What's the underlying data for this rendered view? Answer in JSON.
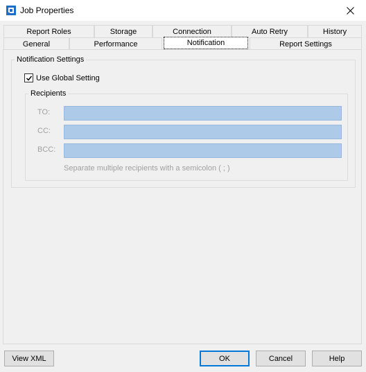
{
  "window": {
    "title": "Job Properties",
    "icon": "app-icon",
    "close_glyph": "✕"
  },
  "tabs": {
    "row1": [
      "Report Roles",
      "Storage",
      "Connection",
      "Auto Retry",
      "History"
    ],
    "row2": [
      "General",
      "Performance",
      "Notification",
      "Report Settings"
    ],
    "active": "Notification"
  },
  "notification": {
    "group_label": "Notification Settings",
    "use_global_label": "Use Global Setting",
    "use_global_checked": true,
    "recipients": {
      "group_label": "Recipients",
      "to_label": "TO:",
      "cc_label": "CC:",
      "bcc_label": "BCC:",
      "to_value": "",
      "cc_value": "",
      "bcc_value": "",
      "hint": "Separate multiple recipients with a semicolon ( ; )"
    }
  },
  "buttons": {
    "view_xml": "View XML",
    "ok": "OK",
    "cancel": "Cancel",
    "help": "Help"
  },
  "colors": {
    "accent": "#0078d7",
    "disabled_input": "#adcae9",
    "background": "#f0f0f0"
  }
}
